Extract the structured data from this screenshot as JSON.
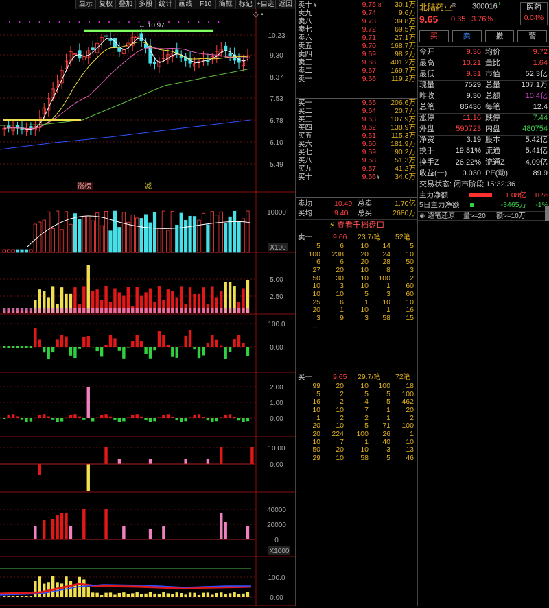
{
  "toolbar": [
    "显示",
    "复权",
    "叠加",
    "多股",
    "统计",
    "画线",
    "F10",
    "简框",
    "标记",
    "+自选",
    "返回"
  ],
  "kline": {
    "yticks": [
      "10.23",
      "9.30",
      "8.37",
      "7.53",
      "6.78",
      "6.10",
      "5.49"
    ],
    "high_label": "10.97",
    "tags": {
      "left": "涨榜",
      "right": "减"
    }
  },
  "volume": {
    "ytick": "10000",
    "unit": "X100"
  },
  "ind1": {
    "yticks": [
      "5.00",
      "2.50"
    ]
  },
  "ind2": {
    "yticks": [
      "100.0",
      "0.00"
    ]
  },
  "ind3": {
    "yticks": [
      "2.00",
      "1.00",
      "0.00"
    ]
  },
  "ind4": {
    "yticks": [
      "10.00",
      "0.00"
    ]
  },
  "ind5": {
    "yticks": [
      "40000",
      "20000",
      "0"
    ],
    "unit": "X1000"
  },
  "ind6": {
    "yticks": [
      "100.0",
      "0.00"
    ]
  },
  "orderbook": {
    "asks": [
      {
        "label": "卖十",
        "mark": "¥",
        "price": "9.75",
        "sub": "8",
        "vol": "30.1万"
      },
      {
        "label": "卖九",
        "price": "9.74",
        "vol": "9.6万"
      },
      {
        "label": "卖八",
        "price": "9.73",
        "vol": "39.8万"
      },
      {
        "label": "卖七",
        "price": "9.72",
        "vol": "69.5万"
      },
      {
        "label": "卖六",
        "price": "9.71",
        "vol": "27.1万"
      },
      {
        "label": "卖五",
        "price": "9.70",
        "vol": "168.7万"
      },
      {
        "label": "卖四",
        "price": "9.69",
        "vol": "98.2万"
      },
      {
        "label": "卖三",
        "price": "9.68",
        "vol": "401.2万"
      },
      {
        "label": "卖二",
        "price": "9.67",
        "vol": "169.7万"
      },
      {
        "label": "卖一",
        "price": "9.66",
        "vol": "119.2万"
      }
    ],
    "bids": [
      {
        "label": "买一",
        "price": "9.65",
        "vol": "206.6万"
      },
      {
        "label": "买二",
        "price": "9.64",
        "vol": "20.7万"
      },
      {
        "label": "买三",
        "price": "9.63",
        "vol": "107.9万"
      },
      {
        "label": "买四",
        "price": "9.62",
        "vol": "138.9万"
      },
      {
        "label": "买五",
        "price": "9.61",
        "vol": "115.3万"
      },
      {
        "label": "买六",
        "price": "9.60",
        "vol": "181.9万"
      },
      {
        "label": "买七",
        "price": "9.59",
        "vol": "90.2万"
      },
      {
        "label": "买八",
        "price": "9.58",
        "vol": "51.3万"
      },
      {
        "label": "买九",
        "price": "9.57",
        "vol": "41.2万"
      },
      {
        "label": "买十",
        "price": "9.56",
        "mark": "¥",
        "vol": "34.0万"
      }
    ],
    "avg": [
      {
        "l1": "卖均",
        "v1": "10.49",
        "l2": "总卖",
        "v2": "1.70亿"
      },
      {
        "l1": "买均",
        "v1": "9.40",
        "l2": "总买",
        "v2": "2680万"
      }
    ],
    "deep_btn": "查看千档盘口",
    "sell_queue": {
      "label": "卖一",
      "price": "9.66",
      "avg": "23.7/笔",
      "count": "52笔",
      "rows": [
        [
          "5",
          "6",
          "10",
          "14",
          "5"
        ],
        [
          "100",
          "238",
          "20",
          "24",
          "10"
        ],
        [
          "6",
          "6",
          "20",
          "28",
          "50"
        ],
        [
          "27",
          "20",
          "10",
          "8",
          "3"
        ],
        [
          "50",
          "30",
          "10",
          "100",
          "2"
        ],
        [
          "10",
          "3",
          "10",
          "1",
          "60"
        ],
        [
          "10",
          "10",
          "5",
          "3",
          "60"
        ],
        [
          "25",
          "6",
          "1",
          "10",
          "10"
        ],
        [
          "20",
          "1",
          "10",
          "1",
          "16"
        ],
        [
          "3",
          "9",
          "3",
          "58",
          "15"
        ]
      ],
      "more": "..."
    },
    "buy_queue": {
      "label": "买一",
      "price": "9.65",
      "avg": "29.7/笔",
      "count": "72笔",
      "rows": [
        [
          "99",
          "20",
          "10",
          "100",
          "18"
        ],
        [
          "5",
          "2",
          "5",
          "5",
          "100"
        ],
        [
          "16",
          "2",
          "4",
          "5",
          "462"
        ],
        [
          "10",
          "10",
          "7",
          "1",
          "20"
        ],
        [
          "1",
          "2",
          "2",
          "1",
          "2"
        ],
        [
          "20",
          "10",
          "5",
          "71",
          "100"
        ],
        [
          "20",
          "224",
          "100",
          "26",
          "1"
        ],
        [
          "10",
          "7",
          "1",
          "40",
          "10"
        ],
        [
          "50",
          "20",
          "10",
          "3",
          "13"
        ],
        [
          "29",
          "10",
          "58",
          "5",
          "46"
        ]
      ]
    }
  },
  "info": {
    "name": "北陆药业",
    "name_mark": "R",
    "code": "300016",
    "code_mark": "L",
    "sector": "医药",
    "sector_pct": "0.04%",
    "price": "9.65",
    "change": "0.35",
    "change_pct": "3.76%",
    "buttons": [
      "买",
      "卖",
      "撤",
      "警"
    ],
    "rows": [
      {
        "l1": "今开",
        "v1": "9.36",
        "c1": "up",
        "l2": "均价",
        "v2": "9.72",
        "c2": "up"
      },
      {
        "l1": "最高",
        "v1": "10.21",
        "c1": "up",
        "l2": "量比",
        "v2": "1.64",
        "c2": "up"
      },
      {
        "l1": "最低",
        "v1": "9.31",
        "c1": "up",
        "l2": "市值",
        "v2": "52.3亿",
        "c2": "wt"
      },
      {
        "l1": "现量",
        "v1": "7529",
        "c1": "wt",
        "l2": "总量",
        "v2": "107.1万",
        "c2": "wt"
      },
      {
        "l1": "昨收",
        "v1": "9.30",
        "c1": "wt",
        "l2": "总额",
        "v2": "10.4亿",
        "c2": "pp"
      },
      {
        "l1": "总笔",
        "v1": "86436",
        "c1": "wt",
        "l2": "每笔",
        "v2": "12.4",
        "c2": "wt"
      },
      {
        "l1": "涨停",
        "v1": "11.16",
        "c1": "up",
        "l2": "跌停",
        "v2": "7.44",
        "c2": "dn"
      },
      {
        "l1": "外盘",
        "v1": "590723",
        "c1": "up",
        "l2": "内盘",
        "v2": "480754",
        "c2": "dn"
      },
      {
        "l1": "净资",
        "v1": "3.19",
        "c1": "wt",
        "l2": "股本",
        "v2": "5.42亿",
        "c2": "wt"
      },
      {
        "l1": "换手",
        "v1": "19.81%",
        "c1": "wt",
        "l2": "流通",
        "v2": "5.41亿",
        "c2": "wt"
      },
      {
        "l1": "换手Z",
        "v1": "26.22%",
        "c1": "wt",
        "l2": "流通Z",
        "v2": "4.09亿",
        "c2": "wt"
      },
      {
        "l1": "收益(一)",
        "v1": "0.030",
        "c1": "wt",
        "l2": "PE(动)",
        "v2": "89.9",
        "c2": "wt"
      }
    ],
    "status": "交易状态: 闭市阶段 15:32:36",
    "flow": [
      {
        "label": "主力净额",
        "value": "1.08亿",
        "pct": "10%",
        "color": "up"
      },
      {
        "label": "5日主力净额",
        "value": "-3465万",
        "pct": "-1%",
        "color": "dn"
      }
    ],
    "zb": {
      "label": "逐笔还原",
      "f1": "量>=20",
      "f2": "额>=10万"
    }
  },
  "colors": {
    "up": "#ff4040",
    "down": "#3cd04c",
    "cyan": "#48e0e8",
    "yellow": "#f0e050",
    "pink": "#f080c0"
  }
}
